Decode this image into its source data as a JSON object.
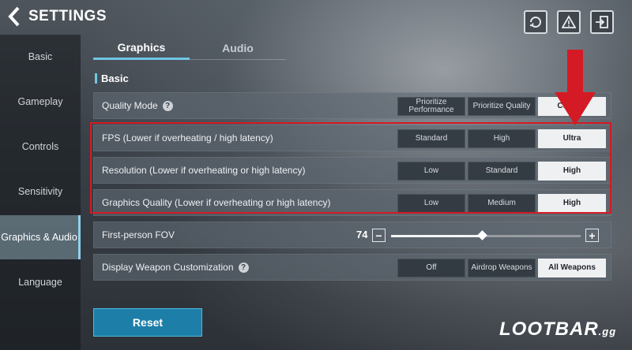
{
  "header": {
    "title": "SETTINGS"
  },
  "colors": {
    "accent": "#6fc6e6",
    "highlight_box": "#d41a24",
    "arrow": "#d41a24",
    "reset_button": "#1d7fa8"
  },
  "icons": {
    "back": "chevron-left-icon",
    "refresh": "refresh-icon",
    "alert": "warning-icon",
    "exit": "exit-icon",
    "help": "question-icon"
  },
  "sidebar": {
    "items": [
      {
        "label": "Basic"
      },
      {
        "label": "Gameplay"
      },
      {
        "label": "Controls"
      },
      {
        "label": "Sensitivity"
      },
      {
        "label": "Graphics & Audio",
        "active": true
      },
      {
        "label": "Language"
      }
    ]
  },
  "tabs": [
    {
      "label": "Graphics",
      "active": true
    },
    {
      "label": "Audio"
    }
  ],
  "section": {
    "title": "Basic"
  },
  "settings": {
    "quality_mode": {
      "label": "Quality Mode",
      "options": [
        "Prioritize Performance",
        "Prioritize Quality",
        "Custom"
      ],
      "selected": "Custom"
    },
    "fps": {
      "label": "FPS (Lower if overheating / high latency)",
      "options": [
        "Standard",
        "High",
        "Ultra"
      ],
      "selected": "Ultra"
    },
    "resolution": {
      "label": "Resolution (Lower if overheating or high latency)",
      "options": [
        "Low",
        "Standard",
        "High"
      ],
      "selected": "High"
    },
    "graphics_quality": {
      "label": "Graphics Quality (Lower if overheating or high latency)",
      "options": [
        "Low",
        "Medium",
        "High"
      ],
      "selected": "High"
    },
    "fov": {
      "label": "First-person FOV",
      "value": "74",
      "minus": "−",
      "plus": "+",
      "fraction": 0.48
    },
    "weapon_customization": {
      "label": "Display Weapon Customization",
      "options": [
        "Off",
        "Airdrop Weapons",
        "All Weapons"
      ],
      "selected": "All Weapons"
    }
  },
  "reset": {
    "label": "Reset"
  },
  "watermark": {
    "main": "LOOTBAR",
    "suffix": ".gg"
  }
}
